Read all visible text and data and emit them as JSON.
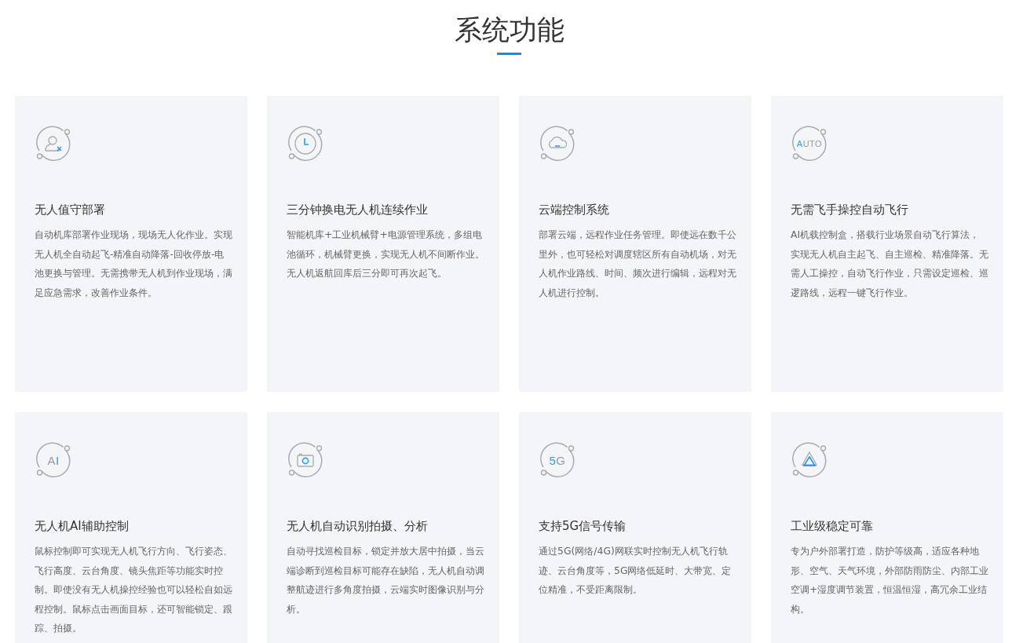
{
  "section": {
    "title": "系统功能"
  },
  "features": [
    {
      "icon": {
        "kind": "user-x"
      },
      "title": "无人值守部署",
      "description": "自动机库部署作业现场，现场无人化作业。实现无人机全自动起飞-精准自动降落-回收停放-电池更换与管理。无需携带无人机到作业现场，满足应急需求，改善作业条件。"
    },
    {
      "icon": {
        "kind": "clock"
      },
      "title": "三分钟换电无人机连续作业",
      "description": "智能机库+工业机械臂+电源管理系统，多组电池循环，机械臂更换，实现无人机不间断作业。无人机返航回库后三分即可再次起飞。"
    },
    {
      "icon": {
        "kind": "cloud"
      },
      "title": "云端控制系统",
      "description": "部署云端，远程作业任务管理。即使远在数千公里外，也可轻松对调度辖区所有自动机场，对无人机作业路线、时间、频次进行编辑，远程对无人机进行控制。"
    },
    {
      "icon": {
        "kind": "text",
        "parts": [
          {
            "text": "A",
            "accent": true
          },
          {
            "text": "UTO",
            "accent": false
          }
        ]
      },
      "title": "无需飞手操控自动飞行",
      "description": "AI机载控制盒，搭载行业场景自动飞行算法，实现无人机自主起飞、自主巡检、精准降落。无需人工操控，自动飞行作业，只需设定巡检、巡逻路线，远程一键飞行作业。"
    },
    {
      "icon": {
        "kind": "text",
        "parts": [
          {
            "text": "A",
            "accent": false
          },
          {
            "text": "I",
            "accent": true
          }
        ]
      },
      "title": "无人机AI辅助控制",
      "description": "鼠标控制即可实现无人机飞行方向、飞行姿态、飞行高度、云台角度、镜头焦距等功能实时控制。即使没有无人机操控经验也可以轻松自如远程控制。鼠标点击画面目标，还可智能锁定、跟踪、拍摄。"
    },
    {
      "icon": {
        "kind": "camera"
      },
      "title": "无人机自动识别拍摄、分析",
      "description": "自动寻找巡检目标，锁定并放大居中拍摄，当云端诊断到巡检目标可能存在缺陷，无人机自动调整航迹进行多角度拍摄，云端实时图像识别与分析。"
    },
    {
      "icon": {
        "kind": "text",
        "parts": [
          {
            "text": "5",
            "accent": true
          },
          {
            "text": "G",
            "accent": false
          }
        ]
      },
      "title": "支持5G信号传输",
      "description": "通过5G(网络/4G)网联实时控制无人机飞行轨迹、云台角度等，5G网络低延时、大带宽、定位精准，不受距离限制。"
    },
    {
      "icon": {
        "kind": "triangle"
      },
      "title": "工业级稳定可靠",
      "description": "专为户外部署打造，防护等级高，适应各种地形、空气、天气环境，外部防雨防尘、内部工业空调+湿度调节装置，恒温恒湿，高冗余工业结构。"
    }
  ]
}
